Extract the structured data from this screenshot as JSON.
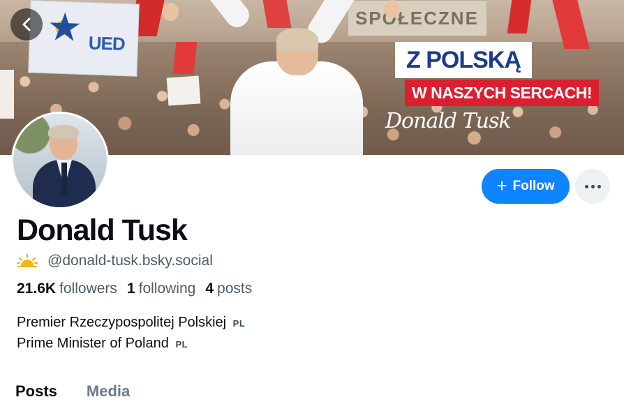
{
  "banner": {
    "eu_sign_text": "UED",
    "placard_text": "SPOŁECZNE",
    "slogan_line1": "Z POLSKĄ",
    "slogan_line2": "W NASZYCH SERCACH!",
    "signature": "Donald Tusk"
  },
  "colors": {
    "follow_button": "#1083fe",
    "slogan_red": "#dc1f2f",
    "slogan_blue": "#1a3a8c",
    "muted_text": "#4f5b6b",
    "tab_inactive": "#6a7b8f"
  },
  "icons": {
    "back": "chevron-left-icon",
    "plus": "plus-icon",
    "more": "more-horizontal-icon",
    "sun": "sun-icon"
  },
  "profile": {
    "display_name": "Donald Tusk",
    "handle": "@donald-tusk.bsky.social",
    "stats": {
      "followers_count": "21.6K",
      "followers_label": "followers",
      "following_count": "1",
      "following_label": "following",
      "posts_count": "4",
      "posts_label": "posts"
    },
    "bio": [
      {
        "text": "Premier Rzeczypospolitej Polskiej",
        "lang": "PL"
      },
      {
        "text": "Prime Minister of Poland",
        "lang": "PL"
      }
    ]
  },
  "actions": {
    "follow_label": "Follow"
  },
  "tabs": [
    {
      "label": "Posts",
      "active": true
    },
    {
      "label": "Media",
      "active": false
    }
  ]
}
